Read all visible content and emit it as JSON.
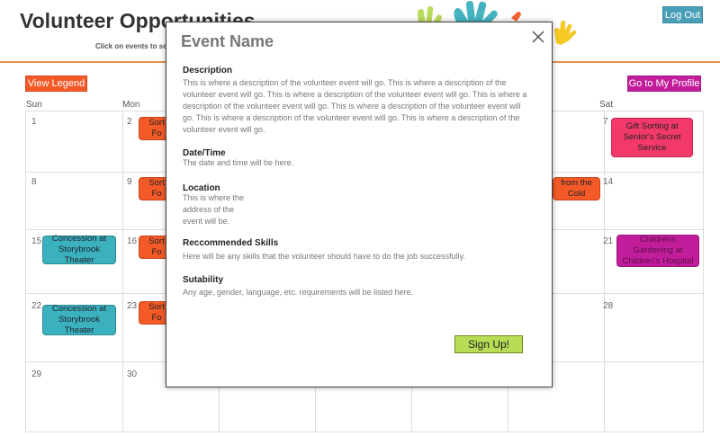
{
  "header": {
    "title": "Volunteer Opportunities",
    "subtitle": "Click on events to see",
    "logout_label": "Log Out"
  },
  "toolbar": {
    "legend_label": "View Legend",
    "profile_label": "Go to My Profile"
  },
  "calendar": {
    "days_of_week": [
      "Sun",
      "Mon",
      "",
      "",
      "",
      "",
      "Sat"
    ],
    "day_numbers": {
      "d1": "1",
      "d2": "2",
      "d7": "7",
      "d8": "8",
      "d9": "9",
      "d14": "14",
      "d15": "15",
      "d16": "16",
      "d21": "21",
      "d22": "22",
      "d23": "23",
      "d28": "28",
      "d29": "29",
      "d30": "30"
    },
    "events": {
      "e_mon1": "Sort\nFo",
      "e_sat7": "Gift Sorting at Senior's Secret Service",
      "e_mon9": "Sort\nFo",
      "e_fri13": "from the\nCold",
      "e_sun15": "Concession at Storybrook Theater",
      "e_mon16": "Sort\nFo",
      "e_sat21": "Childrens Gardening at Children's Hospital",
      "e_sun22": "Concession at Storybrook Theater",
      "e_mon23": "Sort\nFo"
    }
  },
  "modal": {
    "title": "Event Name",
    "description_label": "Description",
    "description_text": "This is where a description of the volunteer event will go. This is where a description of the volunteer event will go. This is where a description of the volunteer event will go. This is where a description of the volunteer event will go. This is where a description of the volunteer event will go. This is where a description of the volunteer event will go. This is where a description of the volunteer event will go.",
    "datetime_label": "Date/Time",
    "datetime_text": "The date and time will be here.",
    "location_label": "Location",
    "location_text": "This is where the address of the event will be.",
    "skills_label": "Reccommended Skills",
    "skills_text": "Here will be any skills that the volunteer should have to do the job successfully.",
    "suitability_label": "Sutability",
    "suitability_text": "Any age, gender, language, etc. requirements will be listed here.",
    "signup_label": "Sign Up!"
  },
  "colors": {
    "accent_orange": "#f35a28",
    "accent_purple": "#c21e9c",
    "teal": "#3ab1bd",
    "lime": "#b8dc56"
  },
  "icons": [
    "hands-logo-icon",
    "close-icon"
  ]
}
